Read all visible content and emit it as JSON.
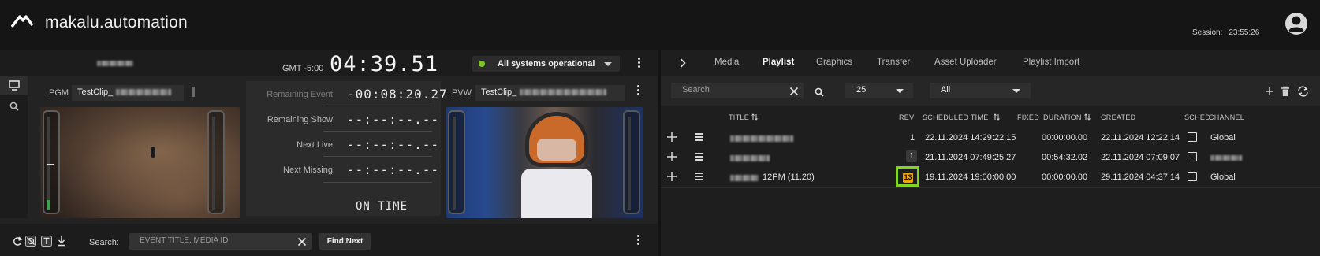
{
  "app": {
    "title": "makalu.automation",
    "session_label": "Session:",
    "session_time": "23:55:26"
  },
  "status": {
    "gmt": "GMT -5:00",
    "clock": "04:39.51",
    "systems": "All systems operational",
    "status_color": "#7cc524"
  },
  "pgm": {
    "label": "PGM",
    "clip": "TestClip_"
  },
  "pvw": {
    "label": "PVW",
    "clip": "TestClip_"
  },
  "timers": [
    {
      "label": "Remaining Event",
      "value": "-00:08:20.27"
    },
    {
      "label": "Remaining Show",
      "value": "--:--:--.--"
    },
    {
      "label": "Next Live",
      "value": "--:--:--.--"
    },
    {
      "label": "Next Missing",
      "value": "--:--:--.--"
    }
  ],
  "on_time": "ON TIME",
  "search": {
    "label": "Search:",
    "placeholder": "EVENT TITLE, MEDIA ID",
    "find_next": "Find Next"
  },
  "tabs": [
    "Media",
    "Playlist",
    "Graphics",
    "Transfer",
    "Asset Uploader",
    "Playlist Import"
  ],
  "active_tab": "Playlist",
  "filters": {
    "search_placeholder": "Search",
    "page_size": "25",
    "scope": "All"
  },
  "table": {
    "headers": {
      "title": "TITLE",
      "rev": "REV",
      "scheduled": "SCHEDULED TIME",
      "fixed": "FIXED",
      "duration": "DURATION",
      "created": "CREATED",
      "sched": "SCHED",
      "channel": "CHANNEL"
    },
    "rows": [
      {
        "title": "",
        "rev": "1",
        "scheduled": "22.11.2024 14:29:22.15",
        "duration": "00:00:00.00",
        "created": "22.11.2024 12:22:14",
        "channel": "Global"
      },
      {
        "title": "",
        "rev": "1",
        "scheduled": "21.11.2024 07:49:25.27",
        "duration": "00:54:32.02",
        "created": "22.11.2024 07:09:07",
        "channel": ""
      },
      {
        "title": "12PM (11.20)",
        "rev": "13",
        "scheduled": "19.11.2024 19:00:00.00",
        "duration": "00:00:00.00",
        "created": "29.11.2024 04:37:14",
        "channel": "Global"
      }
    ]
  },
  "colors": {
    "highlight": "#7fd81c",
    "warning_badge": "#f2a500"
  }
}
